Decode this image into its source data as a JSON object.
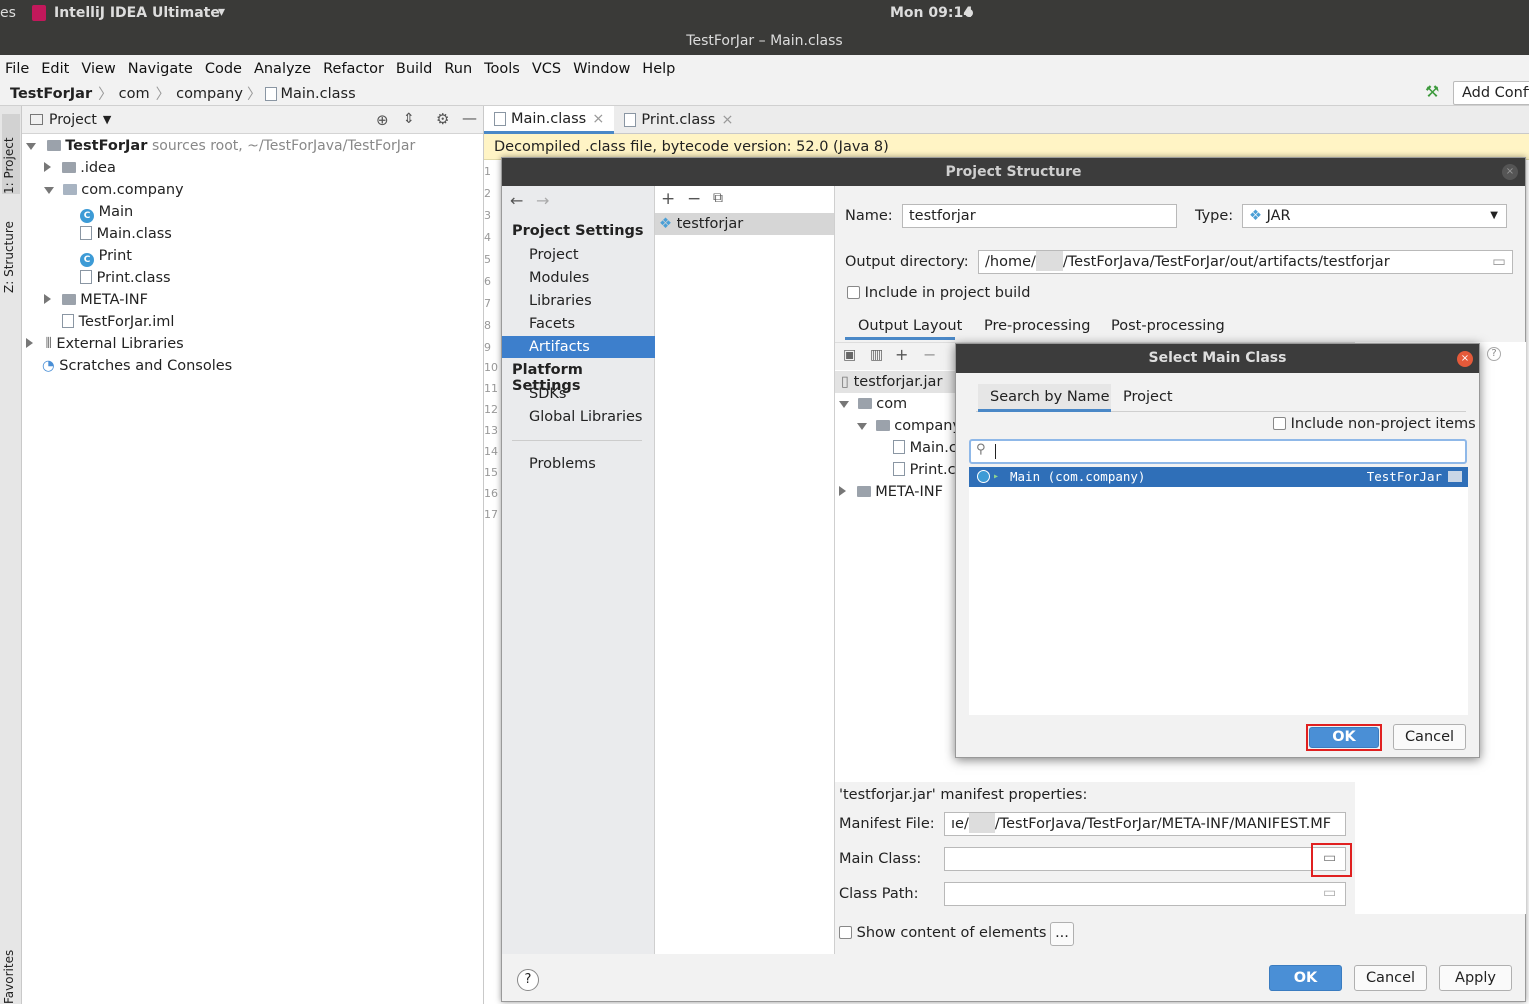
{
  "system": {
    "left_partial": "es",
    "app_name": "IntelliJ IDEA Ultimate",
    "clock": "Mon 09:14"
  },
  "window_title": "TestForJar – Main.class",
  "menu": [
    "File",
    "Edit",
    "View",
    "Navigate",
    "Code",
    "Analyze",
    "Refactor",
    "Build",
    "Run",
    "Tools",
    "VCS",
    "Window",
    "Help"
  ],
  "breadcrumb": {
    "project": "TestForJar",
    "pkg1": "com",
    "pkg2": "company",
    "file": "Main.class",
    "run_config": "Add Confi"
  },
  "side_tabs": {
    "project": "1: Project",
    "structure": "Z: Structure",
    "favorites": "Favorites"
  },
  "project_panel": {
    "title": "Project",
    "root": "TestForJar",
    "root_hint": "sources root,  ~/TestForJava/TestForJar",
    "items": [
      ".idea",
      "com.company",
      "Main",
      "Main.class",
      "Print",
      "Print.class",
      "META-INF",
      "TestForJar.iml",
      "External Libraries",
      "Scratches and Consoles"
    ]
  },
  "editor": {
    "tabs": [
      "Main.class",
      "Print.class"
    ],
    "banner": "Decompiled .class file, bytecode version: 52.0 (Java 8)",
    "line_numbers": [
      "1",
      "2",
      "3",
      "4",
      "5",
      "6",
      "7",
      "8",
      "9",
      "10",
      "11",
      "12",
      "13",
      "14",
      "15",
      "16",
      "17"
    ]
  },
  "project_structure": {
    "title": "Project Structure",
    "project_settings": "Project Settings",
    "nav": [
      "Project",
      "Modules",
      "Libraries",
      "Facets",
      "Artifacts"
    ],
    "platform_settings": "Platform Settings",
    "platform_nav": [
      "SDKs",
      "Global Libraries"
    ],
    "problems": "Problems",
    "artifact": "testforjar",
    "name_label": "Name:",
    "name_value": "testforjar",
    "type_label": "Type:",
    "type_value": "JAR",
    "output_label": "Output directory:",
    "output_prefix": "/home/",
    "output_suffix": "/TestForJava/TestForJar/out/artifacts/testforjar",
    "include_build": "Include in project build",
    "tabs": [
      "Output Layout",
      "Pre-processing",
      "Post-processing"
    ],
    "layout_tree": [
      "testforjar.jar",
      "com",
      "company",
      "Main.c",
      "Print.c",
      "META-INF"
    ],
    "manifest_heading": "'testforjar.jar' manifest properties:",
    "manifest_file_label": "Manifest File:",
    "manifest_prefix": "ıe/",
    "manifest_suffix": "/TestForJava/TestForJar/META-INF/MANIFEST.MF",
    "main_class_label": "Main Class:",
    "main_class_value": "",
    "class_path_label": "Class Path:",
    "class_path_value": "",
    "show_content": "Show content of elements",
    "ellipsis": "...",
    "help": "?",
    "ok": "OK",
    "cancel": "Cancel",
    "apply": "Apply"
  },
  "select_main_class": {
    "title": "Select Main Class",
    "tabs": [
      "Search by Name",
      "Project"
    ],
    "include_non_project": "Include non-project items",
    "search_value": "",
    "result_name": "Main (com.company)",
    "result_module": "TestForJar",
    "ok": "OK",
    "cancel": "Cancel"
  }
}
